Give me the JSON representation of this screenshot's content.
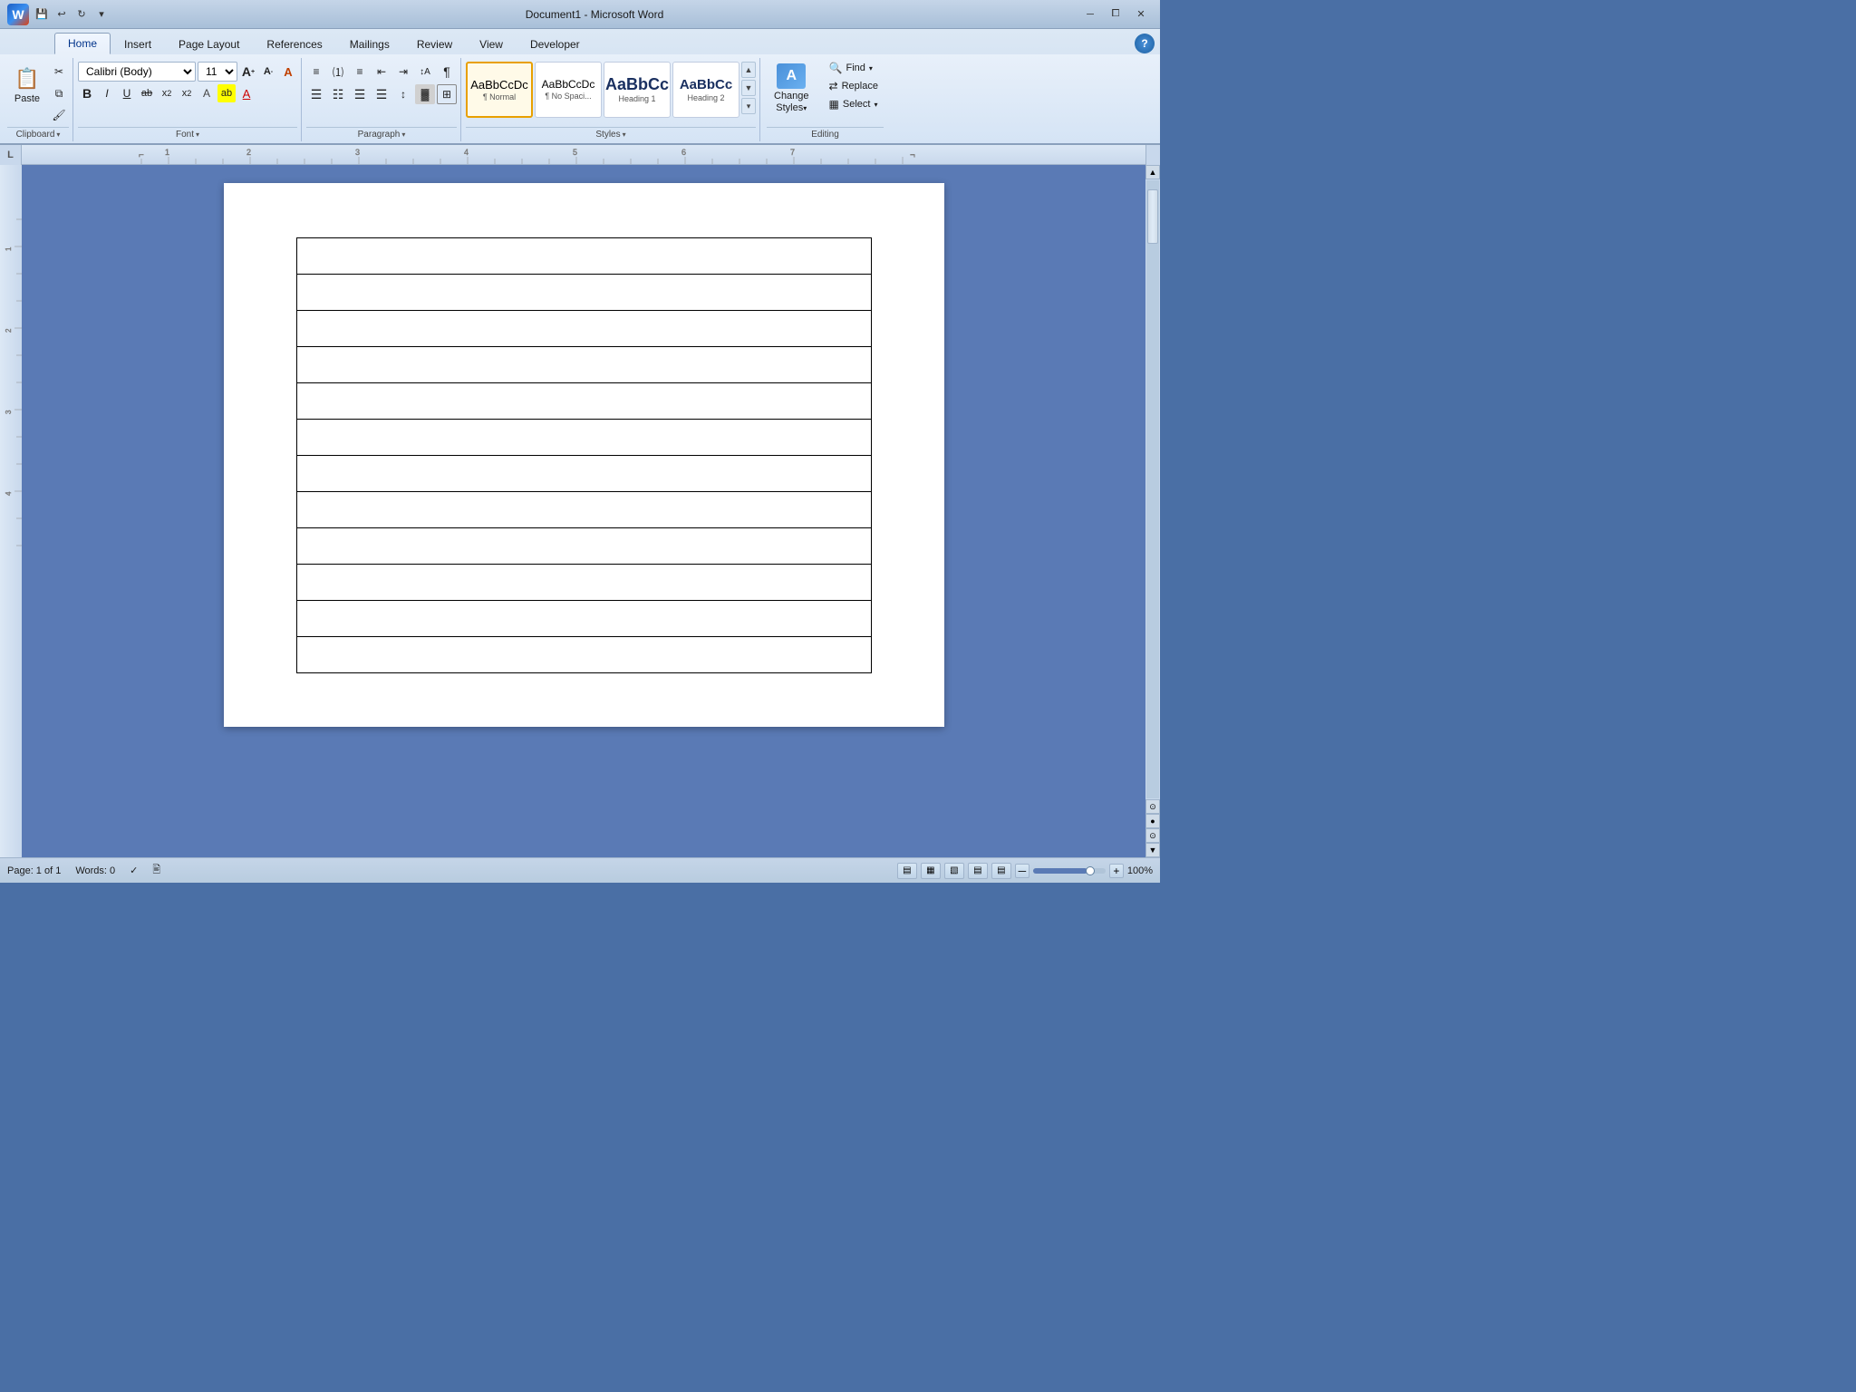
{
  "titlebar": {
    "title": "Document1 - Microsoft Word",
    "app_icon_label": "W",
    "quick_access": {
      "save_label": "💾",
      "undo_label": "↩",
      "redo_label": "↻",
      "dropdown_label": "▾"
    },
    "controls": {
      "minimize": "─",
      "restore": "⧠",
      "close": "✕"
    }
  },
  "ribbon": {
    "tabs": [
      {
        "id": "home",
        "label": "Home",
        "active": true
      },
      {
        "id": "insert",
        "label": "Insert",
        "active": false
      },
      {
        "id": "pagelayout",
        "label": "Page Layout",
        "active": false
      },
      {
        "id": "references",
        "label": "References",
        "active": false
      },
      {
        "id": "mailings",
        "label": "Mailings",
        "active": false
      },
      {
        "id": "review",
        "label": "Review",
        "active": false
      },
      {
        "id": "view",
        "label": "View",
        "active": false
      },
      {
        "id": "developer",
        "label": "Developer",
        "active": false
      }
    ],
    "groups": {
      "clipboard": {
        "label": "Clipboard",
        "paste_label": "Paste",
        "cut_label": "✂",
        "copy_label": "⧉",
        "format_painter_label": "🖌"
      },
      "font": {
        "label": "Font",
        "font_name": "Calibri (Body)",
        "font_size": "11",
        "grow_label": "A",
        "shrink_label": "A",
        "clear_label": "A",
        "bold_label": "B",
        "italic_label": "I",
        "underline_label": "U",
        "strike_label": "ab",
        "sub_label": "x₂",
        "sup_label": "x²",
        "color_label": "A",
        "highlight_label": "ab"
      },
      "paragraph": {
        "label": "Paragraph",
        "bullets_label": "≡",
        "numbering_label": "≡",
        "multilevel_label": "≡",
        "decrease_indent_label": "⇤",
        "increase_indent_label": "⇥",
        "sort_label": "↕A",
        "show_marks_label": "¶",
        "align_left_label": "≡",
        "align_center_label": "≡",
        "align_right_label": "≡",
        "justify_label": "≡",
        "line_spacing_label": "↕",
        "shading_label": "▓",
        "borders_label": "⊞"
      },
      "styles": {
        "label": "Styles",
        "items": [
          {
            "id": "normal",
            "text": "AaBbCcDc",
            "label": "¶ Normal",
            "active": true
          },
          {
            "id": "nospacing",
            "text": "AaBbCcDc",
            "label": "¶ No Spaci..."
          },
          {
            "id": "heading1",
            "text": "AaBbCc",
            "label": "Heading 1"
          },
          {
            "id": "heading2",
            "text": "AaBbCc",
            "label": "Heading 2"
          }
        ]
      },
      "editing": {
        "label": "Editing",
        "find_label": "Find",
        "find_arrow": "▾",
        "replace_label": "Replace",
        "select_label": "Select",
        "select_arrow": "▾",
        "change_styles_label": "Change\nStyles",
        "change_styles_icon": "A"
      }
    }
  },
  "ruler": {
    "corner_label": "L"
  },
  "document": {
    "table_rows": 12,
    "table_cols": 1
  },
  "statusbar": {
    "page_label": "Page: 1 of 1",
    "words_label": "Words: 0",
    "check_icon": "✓",
    "print_layout_icon": "▤",
    "full_reading_icon": "▦",
    "web_layout_icon": "▧",
    "outline_icon": "▤",
    "draft_icon": "▤",
    "zoom_level": "100%",
    "zoom_minus": "─",
    "zoom_plus": "+"
  }
}
